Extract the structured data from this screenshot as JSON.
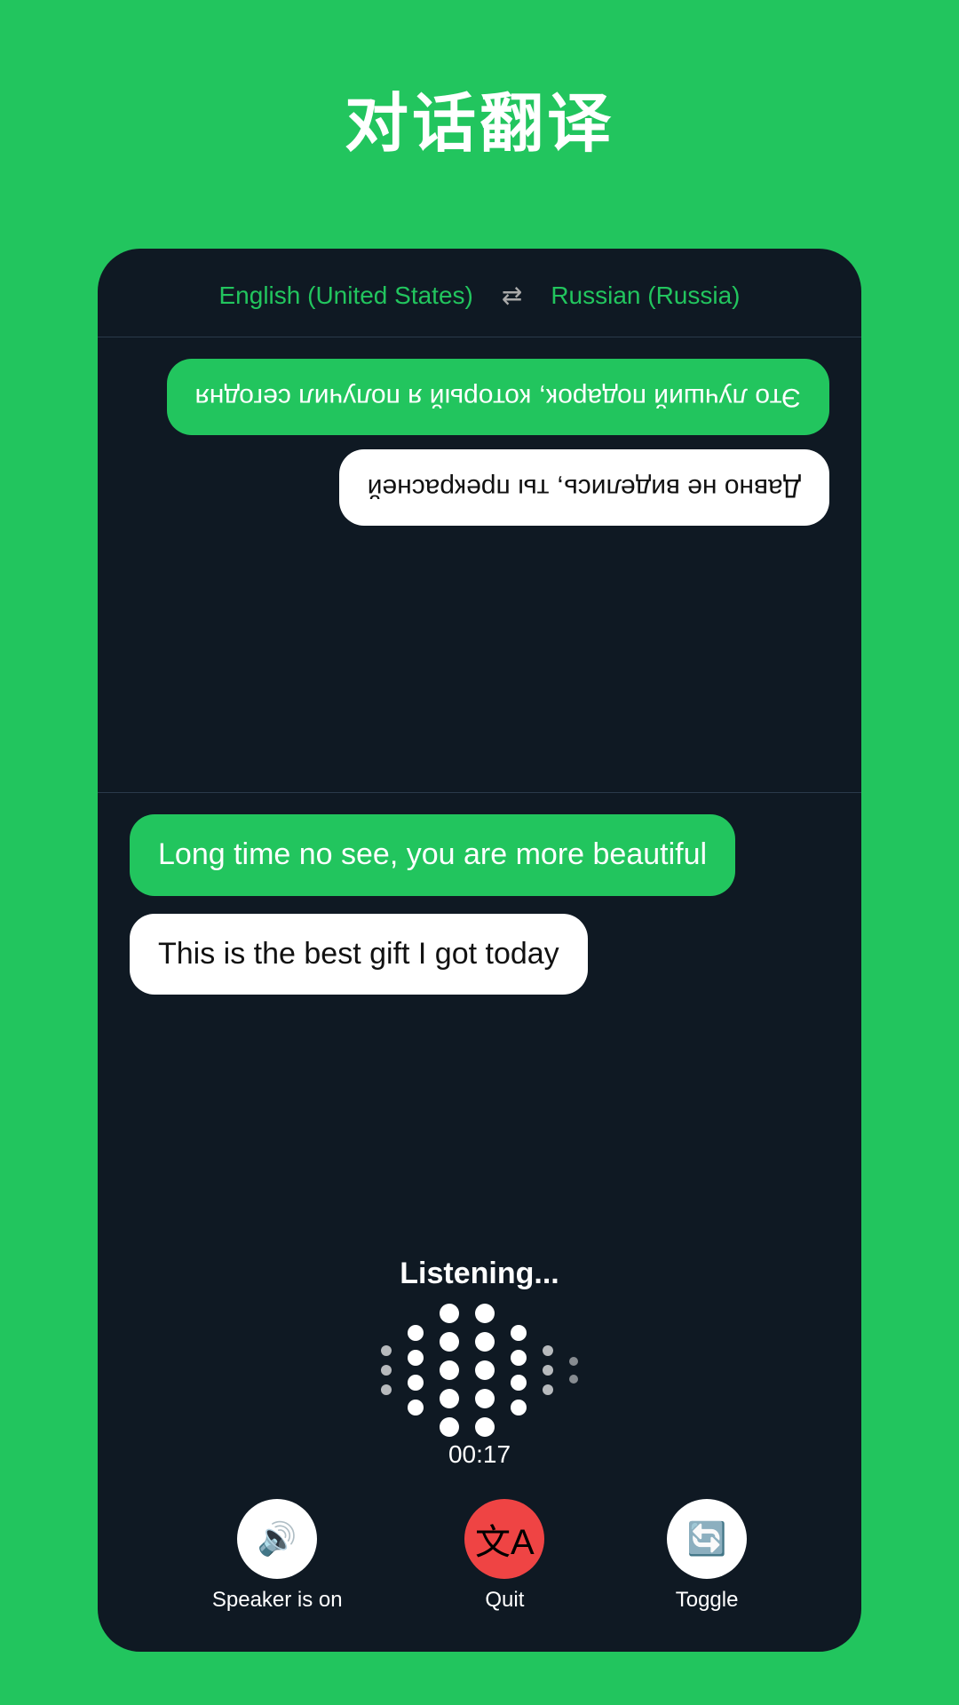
{
  "title": "对话翻译",
  "card": {
    "lang_left": "English (United States)",
    "lang_right": "Russian (Russia)",
    "upper": {
      "bubble_green": "Это лучший подарок, который я получил сегодня",
      "bubble_white": "Давно не виделись, ты прекрасней"
    },
    "lower": {
      "bubble_green": "Long time no see, you are more beautiful",
      "bubble_white": "This is the best gift I got today"
    },
    "listening_label": "Listening...",
    "timer": "00:17",
    "controls": {
      "speaker_label": "Speaker is on",
      "quit_label": "Quit",
      "toggle_label": "Toggle"
    }
  },
  "colors": {
    "green": "#22c55e",
    "dark_bg": "#0f1923",
    "red": "#ef4444"
  }
}
